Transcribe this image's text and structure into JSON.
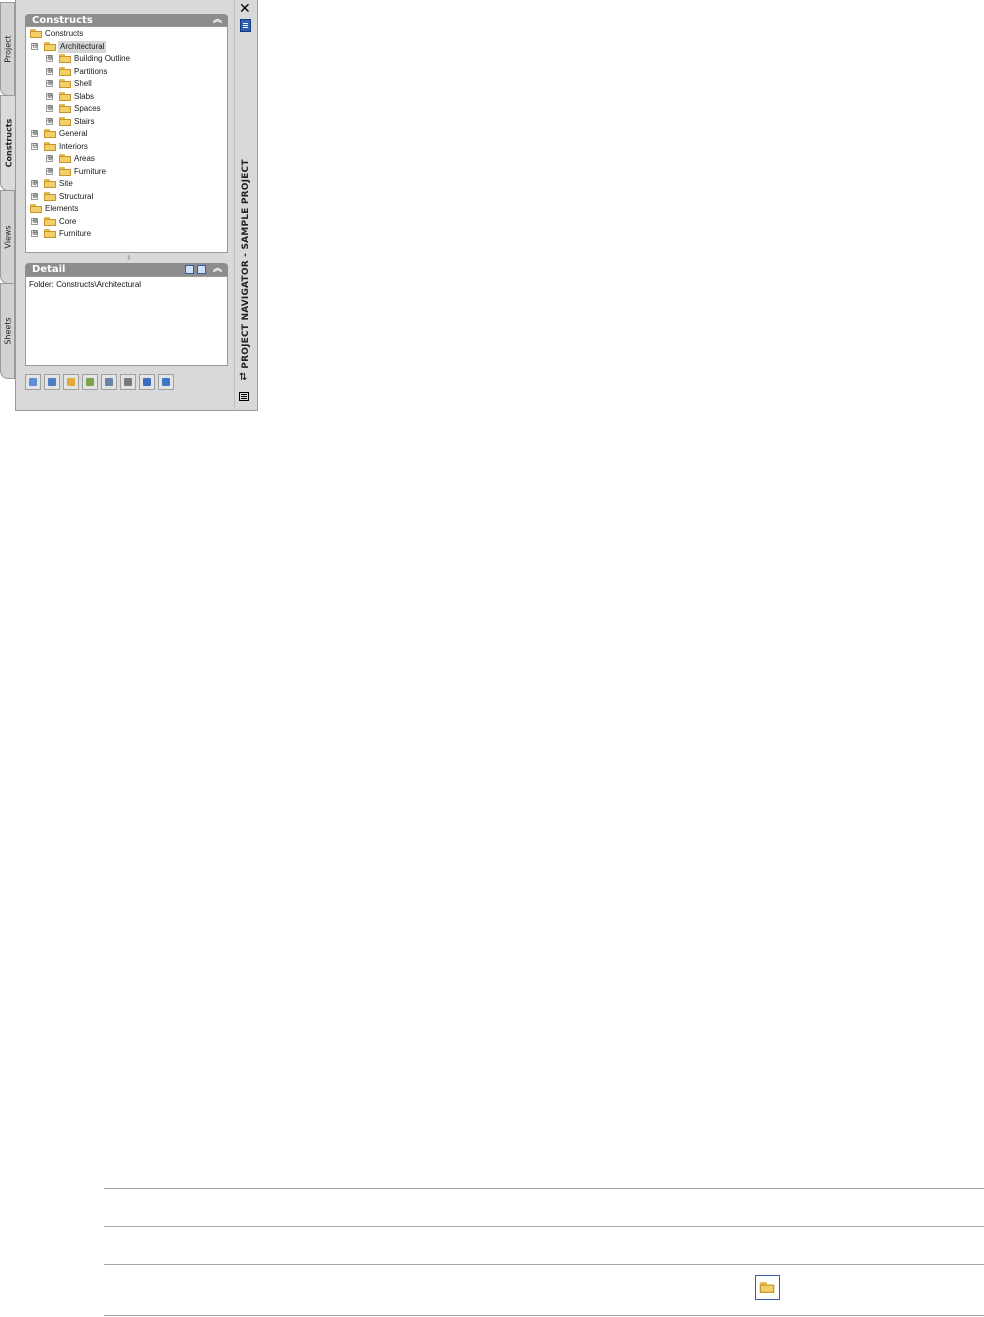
{
  "palette": {
    "title": "PROJECT NAVIGATOR - SAMPLE PROJECT",
    "tabs": [
      {
        "label": "Project"
      },
      {
        "label": "Constructs"
      },
      {
        "label": "Views"
      },
      {
        "label": "Sheets"
      }
    ],
    "constructs_section": {
      "title": "Constructs"
    },
    "tree": [
      {
        "label": "Constructs",
        "expander": ""
      },
      {
        "label": "Architectural",
        "expander": "⊖"
      },
      {
        "label": "Building Outline",
        "expander": "⊕"
      },
      {
        "label": "Partitions",
        "expander": "⊕"
      },
      {
        "label": "Shell",
        "expander": "⊕"
      },
      {
        "label": "Slabs",
        "expander": "⊕"
      },
      {
        "label": "Spaces",
        "expander": "⊕"
      },
      {
        "label": "Stairs",
        "expander": "⊕"
      },
      {
        "label": "General",
        "expander": "⊕"
      },
      {
        "label": "Interiors",
        "expander": "⊖"
      },
      {
        "label": "Areas",
        "expander": "⊕"
      },
      {
        "label": "Furniture",
        "expander": "⊕"
      },
      {
        "label": "Site",
        "expander": "⊕"
      },
      {
        "label": "Structural",
        "expander": "⊕"
      },
      {
        "label": "Elements",
        "expander": ""
      },
      {
        "label": "Core",
        "expander": "⊕"
      },
      {
        "label": "Furniture",
        "expander": "⊕"
      }
    ],
    "detail_section": {
      "title": "Detail",
      "text": "Folder: Constructs\\Architectural"
    },
    "toolbar_icons": [
      "add-construct-icon",
      "add-element-icon",
      "add-category-icon",
      "xref-icon",
      "filter-icon",
      "table-icon",
      "refresh-icon",
      "repath-icon"
    ]
  },
  "colors": {
    "panel_bg": "#d9d9d9",
    "section_header": "#8d8d8d",
    "folder": "#f1cf6a",
    "accent_blue": "#2f5fb0"
  }
}
